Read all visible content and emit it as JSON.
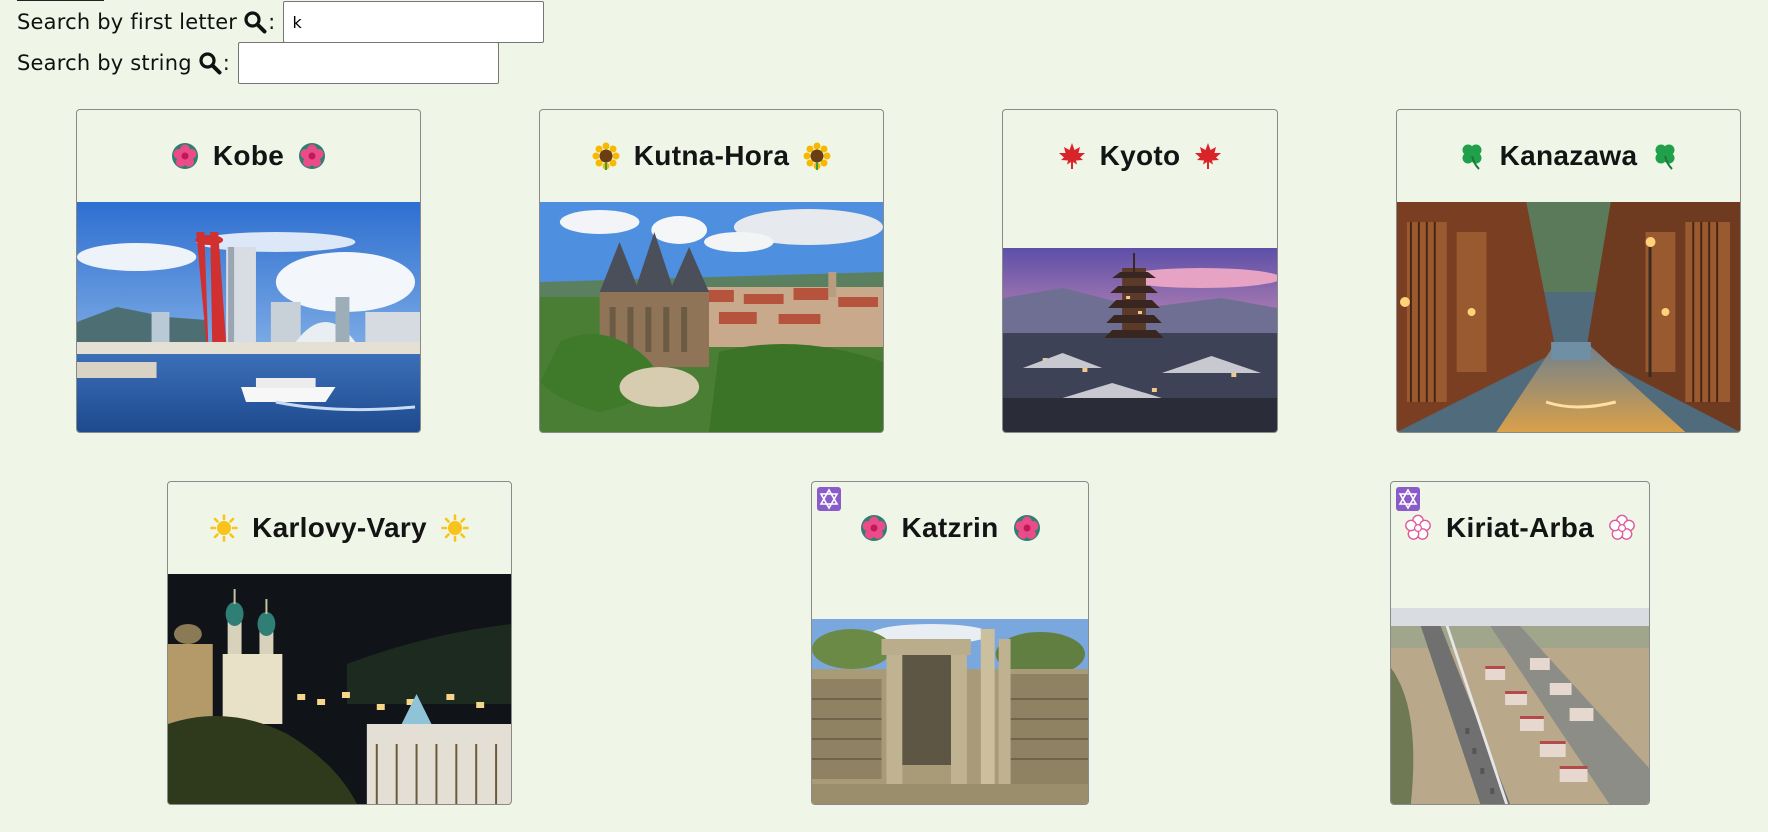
{
  "search": {
    "first_letter_label": "Search by first letter",
    "first_letter_value": "k",
    "string_label": "Search by string",
    "string_value": "",
    "colon": ":",
    "icon": "magnifier-icon"
  },
  "cards": [
    {
      "name": "Kobe",
      "emoji_icon": "pink-flower-icon",
      "badge_icon": null
    },
    {
      "name": "Kutna-Hora",
      "emoji_icon": "sunflower-icon",
      "badge_icon": null
    },
    {
      "name": "Kyoto",
      "emoji_icon": "maple-leaf-icon",
      "badge_icon": null
    },
    {
      "name": "Kanazawa",
      "emoji_icon": "four-leaf-clover-icon",
      "badge_icon": null
    },
    {
      "name": "Karlovy-Vary",
      "emoji_icon": "sun-icon",
      "badge_icon": null
    },
    {
      "name": "Katzrin",
      "emoji_icon": "pink-flower-icon",
      "badge_icon": "star-of-david-icon"
    },
    {
      "name": "Kiriat-Arba",
      "emoji_icon": "white-flower-icon",
      "badge_icon": "star-of-david-icon"
    }
  ],
  "colors": {
    "background": "#eff6e8",
    "badge": "#8a5cc9",
    "card_border": "#8a8a8a"
  }
}
